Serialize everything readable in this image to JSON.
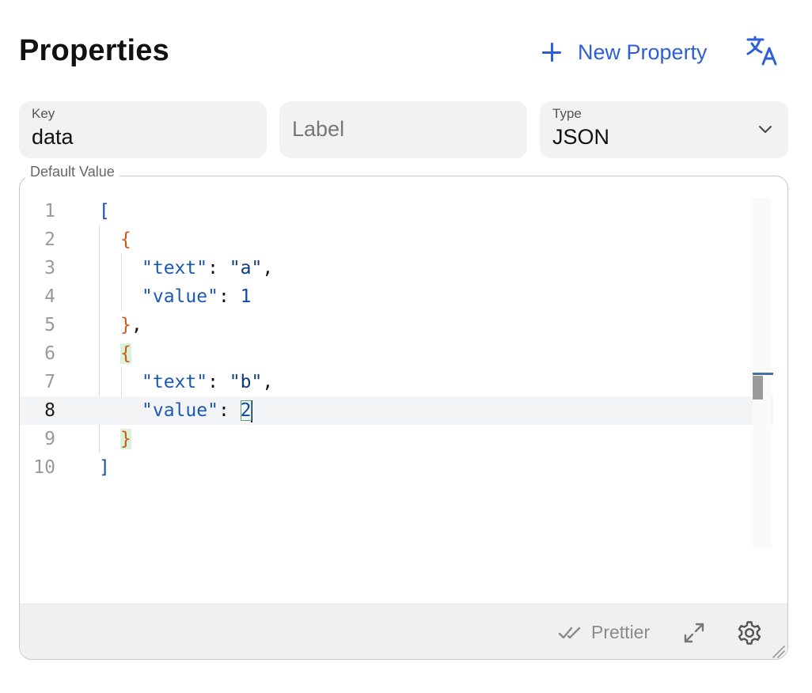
{
  "header": {
    "title": "Properties",
    "new_property_label": "New Property"
  },
  "fields": {
    "key": {
      "label": "Key",
      "value": "data"
    },
    "label": {
      "placeholder": "Label"
    },
    "type": {
      "label": "Type",
      "value": "JSON"
    }
  },
  "editor": {
    "legend": "Default Value",
    "line_numbers": [
      "1",
      "2",
      "3",
      "4",
      "5",
      "6",
      "7",
      "8",
      "9",
      "10"
    ],
    "active_line": 8,
    "tokens": {
      "open_bracket": "[",
      "close_bracket": "]",
      "open_brace": "{",
      "close_brace": "}",
      "comma": ",",
      "colon": ": ",
      "key_text": "\"text\"",
      "key_value": "\"value\"",
      "str_a": "\"a\"",
      "str_b": "\"b\"",
      "num_1": "1",
      "num_2": "2"
    }
  },
  "footer": {
    "prettier_label": "Prettier"
  },
  "icons": {
    "add": "plus-icon",
    "translate": "translate-icon",
    "dropdown": "chevron-down-icon",
    "prettier": "double-check-icon",
    "expand": "expand-icon",
    "settings": "gear-icon",
    "resize": "resize-handle-icon"
  },
  "colors": {
    "accent": "#2e5fd6",
    "field_bg": "#f2f2f2",
    "bracket": "#1b4fa8",
    "brace": "#c9591c",
    "json_key": "#1c58b0",
    "json_string": "#0e3a7c"
  }
}
